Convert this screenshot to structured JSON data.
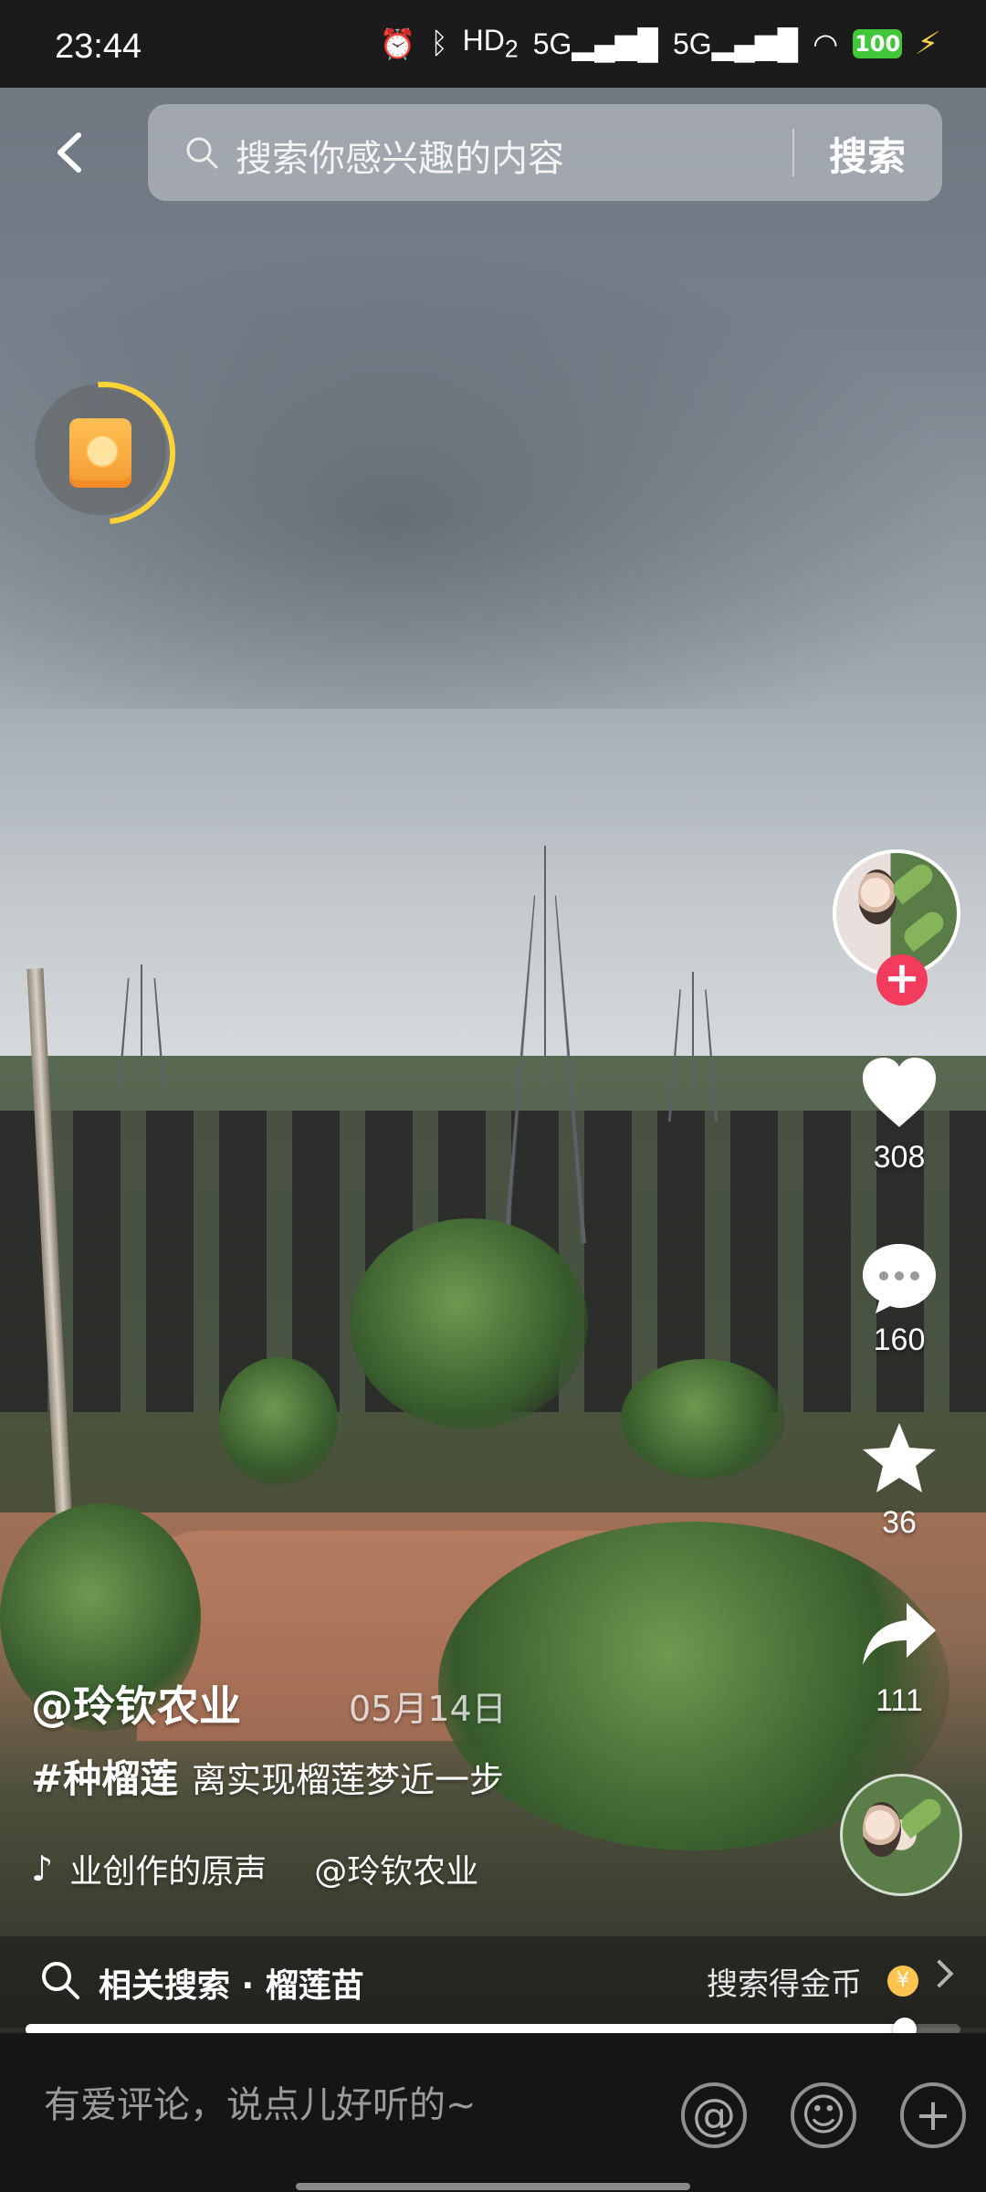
{
  "status_bar": {
    "time": "23:44",
    "battery": "100",
    "icons": [
      "alarm-icon",
      "bluetooth-icon",
      "hd-icon",
      "signal-icon",
      "signal-icon",
      "wifi-icon",
      "battery-icon",
      "charging-icon"
    ],
    "hd_label": "HD",
    "hd_subscript": "2",
    "network_label_1": "5G",
    "network_label_2": "5G"
  },
  "search": {
    "placeholder": "搜索你感兴趣的内容",
    "button": "搜索"
  },
  "actions": {
    "likes": "308",
    "comments": "160",
    "favorites": "36",
    "shares": "111",
    "follow_symbol": "+"
  },
  "caption": {
    "author": "@玲钦农业",
    "date": "05月14日",
    "hashtag": "#种榴莲",
    "text": "离实现榴莲梦近一步",
    "music_text": "业创作的原声",
    "music_author": "@玲钦农业"
  },
  "related": {
    "text": "相关搜索 · 榴莲苗",
    "coin_text": "搜索得金币",
    "coin_symbol": "¥"
  },
  "progress": {
    "value": 0.94
  },
  "comment_bar": {
    "placeholder": "有爱评论，说点儿好听的~",
    "at_symbol": "@",
    "emoji_symbol": "☺",
    "plus_symbol": "+"
  },
  "colors": {
    "accent": "#f33b5d",
    "coin": "#ffc34f",
    "battery": "#42c73b"
  }
}
